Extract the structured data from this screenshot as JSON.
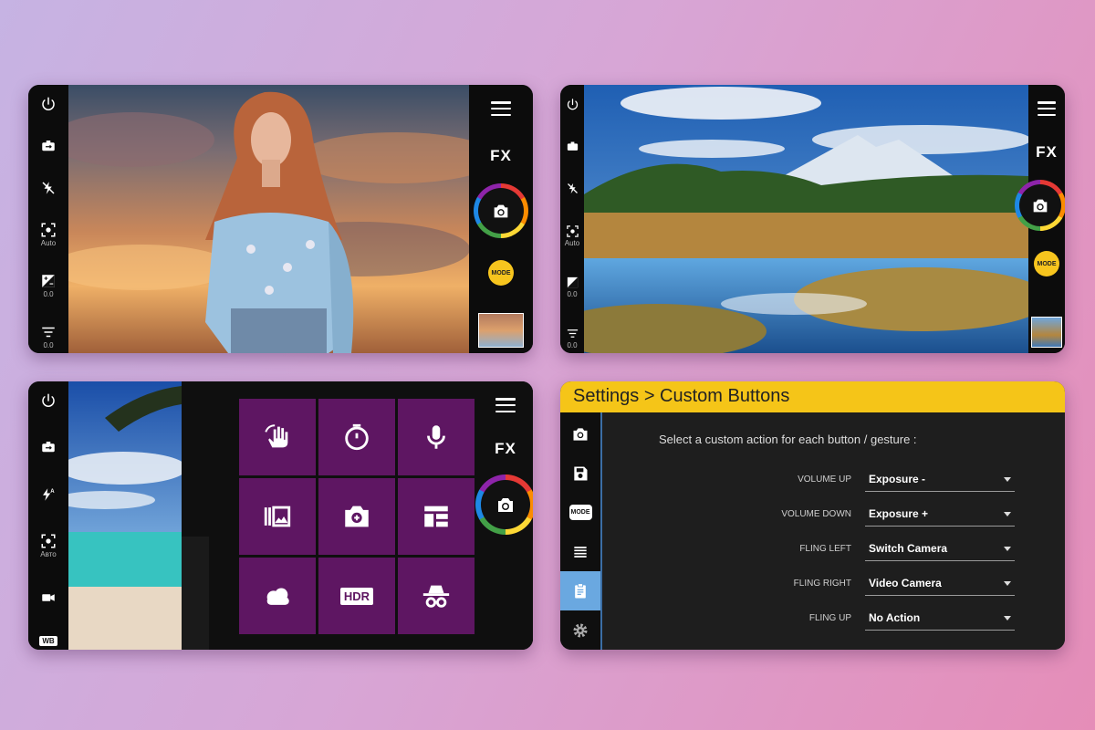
{
  "camera_ui": {
    "fx_label": "FX",
    "mode_label": "MODE",
    "auto_label": "Auto",
    "auto_label_ru": "Авто",
    "exposure_value": "0.0",
    "filter_value": "0.0",
    "wb_label": "WB",
    "hdr_label": "HDR"
  },
  "settings": {
    "title": "Settings > Custom Buttons",
    "intro": "Select a custom action for each button / gesture :",
    "rows": [
      {
        "label": "VOLUME UP",
        "value": "Exposure -"
      },
      {
        "label": "VOLUME DOWN",
        "value": "Exposure +"
      },
      {
        "label": "FLING LEFT",
        "value": "Switch Camera"
      },
      {
        "label": "FLING RIGHT",
        "value": "Video Camera"
      },
      {
        "label": "FLING UP",
        "value": "No Action"
      }
    ]
  },
  "colors": {
    "accent_yellow": "#f5c518",
    "tile_purple": "#5e1662",
    "active_blue": "#6aa8e0"
  },
  "icons": [
    "power-icon",
    "camera-switch-icon",
    "flash-off-icon",
    "focus-icon",
    "exposure-icon",
    "filter-icon",
    "menu-icon",
    "shutter-camera-icon",
    "gesture-icon",
    "timer-icon",
    "microphone-icon",
    "gallery-icon",
    "camera-add-icon",
    "layout-icon",
    "cloud-icon",
    "hdr-icon",
    "incognito-icon",
    "flash-auto-icon",
    "video-icon",
    "save-icon",
    "list-icon",
    "clipboard-icon",
    "settings-gear-icon"
  ]
}
